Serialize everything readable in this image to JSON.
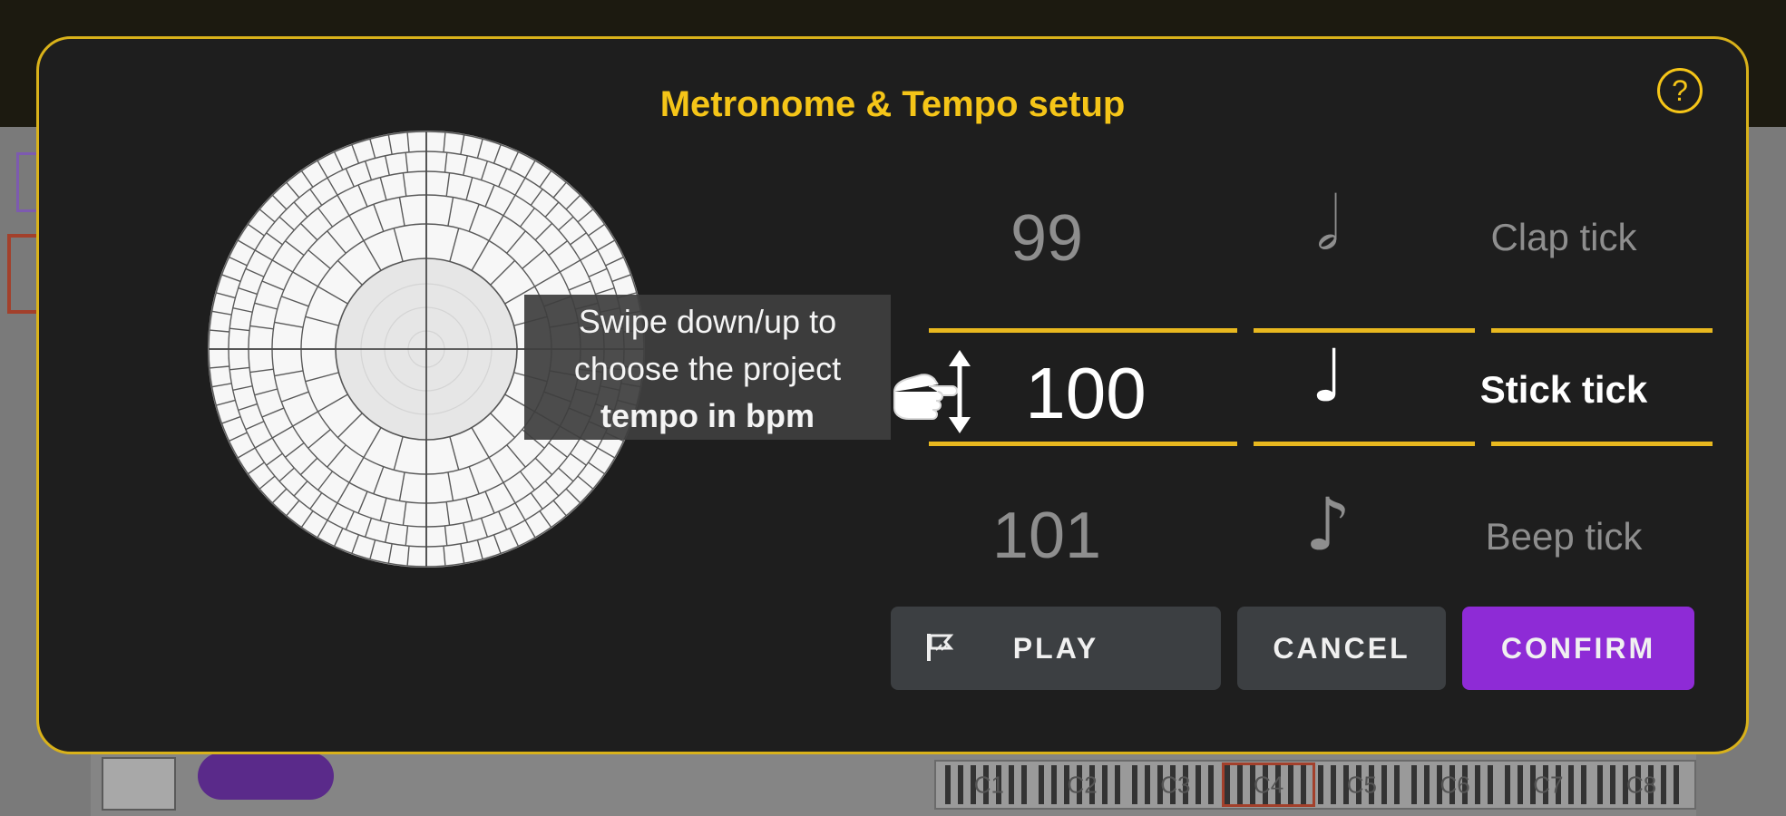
{
  "dialog": {
    "title": "Metronome & Tempo setup",
    "help_label": "?"
  },
  "tooltip": {
    "line1": "Swipe down/up to",
    "line2": "choose the project",
    "line3_bold": "tempo in bpm"
  },
  "tempo_picker": {
    "prev": "99",
    "selected": "100",
    "next": "101"
  },
  "note_picker": {
    "prev": "𝅗𝅥",
    "selected": "♩",
    "next": "♪"
  },
  "tick_picker": {
    "prev": "Clap tick",
    "selected": "Stick tick",
    "next": "Beep tick"
  },
  "buttons": {
    "play": "PLAY",
    "cancel": "CANCEL",
    "confirm": "CONFIRM"
  },
  "background_piano": {
    "octaves": [
      "C1",
      "C2",
      "C3",
      "C4",
      "C5",
      "C6",
      "C7",
      "C8"
    ],
    "active": "C4"
  },
  "colors": {
    "accent": "#f5c518",
    "confirm": "#8e2bd6",
    "dialog_bg": "#1e1e1e"
  }
}
